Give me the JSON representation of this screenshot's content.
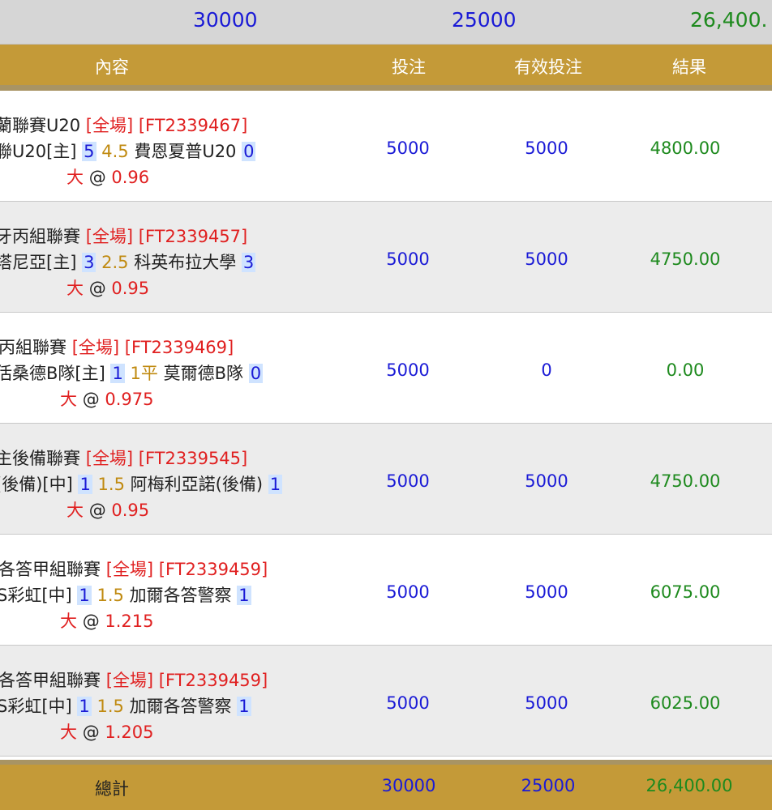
{
  "summary": {
    "bet": "30000",
    "valid": "25000",
    "result": "26,400."
  },
  "header": {
    "content": "內容",
    "bet": "投注",
    "valid": "有效投注",
    "result": "結果"
  },
  "rows": [
    {
      "league": "蘭聯賽U20",
      "period": "[全場]",
      "code": "[FT2339467]",
      "home": "聯U20[主]",
      "home_score": "5",
      "line": "4.5",
      "away": "費恩夏普U20",
      "away_score": "0",
      "pick": "大",
      "at": "@",
      "odds": "0.96",
      "bet": "5000",
      "valid": "5000",
      "result": "4800.00"
    },
    {
      "league": "牙丙組聯賽",
      "period": "[全場]",
      "code": "[FT2339457]",
      "home": "塔尼亞[主]",
      "home_score": "3",
      "line": "2.5",
      "away": "科英布拉大學",
      "away_score": "3",
      "pick": "大",
      "at": "@",
      "odds": "0.95",
      "bet": "5000",
      "valid": "5000",
      "result": "4750.00"
    },
    {
      "league": "丙組聯賽",
      "period": "[全場]",
      "code": "[FT2339469]",
      "home": "佸桑德B隊[主]",
      "home_score": "1",
      "line": "1平",
      "away": "莫爾德B隊",
      "away_score": "0",
      "pick": "大",
      "at": "@",
      "odds": "0.975",
      "bet": "5000",
      "valid": "0",
      "result": "0.00"
    },
    {
      "league": "主後備聯賽",
      "period": "[全場]",
      "code": "[FT2339545]",
      "home": "(後備)[中]",
      "home_score": "1",
      "line": "1.5",
      "away": "阿梅利亞諾(後備)",
      "away_score": "1",
      "pick": "大",
      "at": "@",
      "odds": "0.95",
      "bet": "5000",
      "valid": "5000",
      "result": "4750.00"
    },
    {
      "league": "各答甲組聯賽",
      "period": "[全場]",
      "code": "[FT2339459]",
      "home": "S彩虹[中]",
      "home_score": "1",
      "line": "1.5",
      "away": "加爾各答警察",
      "away_score": "1",
      "pick": "大",
      "at": "@",
      "odds": "1.215",
      "bet": "5000",
      "valid": "5000",
      "result": "6075.00"
    },
    {
      "league": "各答甲組聯賽",
      "period": "[全場]",
      "code": "[FT2339459]",
      "home": "S彩虹[中]",
      "home_score": "1",
      "line": "1.5",
      "away": "加爾各答警察",
      "away_score": "1",
      "pick": "大",
      "at": "@",
      "odds": "1.205",
      "bet": "5000",
      "valid": "5000",
      "result": "6025.00"
    }
  ],
  "footer": {
    "label": "總計",
    "bet": "30000",
    "valid": "25000",
    "result": "26,400.00"
  },
  "colors": {
    "header": "#c49a38",
    "blue": "#1a1ad6",
    "green": "#1e8a1e",
    "red": "#e02020",
    "gold": "#c08a10"
  }
}
